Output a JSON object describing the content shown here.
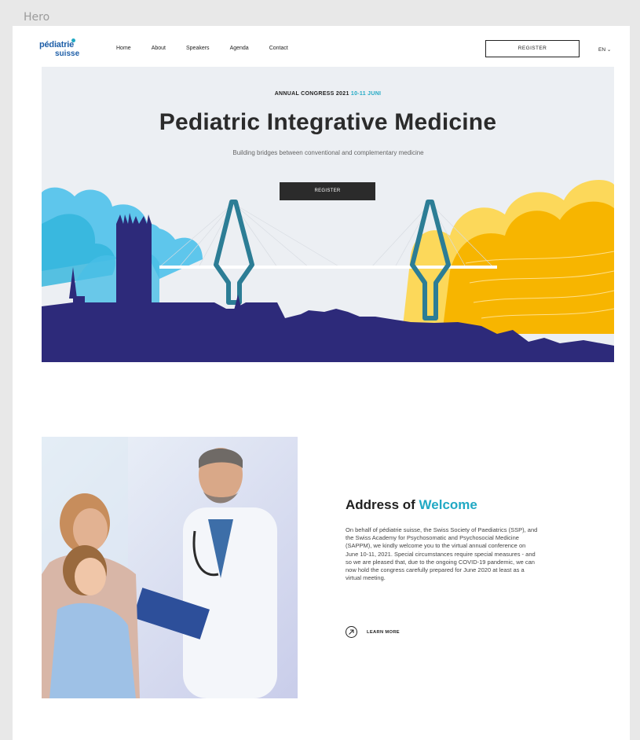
{
  "frame_label": "Hero",
  "nav": {
    "logo_line1": "pédiatrie",
    "logo_line2": "suisse",
    "items": [
      "Home",
      "About",
      "Speakers",
      "Agenda",
      "Contact"
    ],
    "register": "REGISTER",
    "language": "EN ⌄"
  },
  "hero": {
    "eyebrow": "ANNUAL CONGRESS 2021",
    "eyebrow_dates": "10-11 JUNI",
    "title": "Pediatric Integrative Medicine",
    "subtitle": "Building bridges between conventional and complementary medicine",
    "button": "REGISTER"
  },
  "welcome": {
    "title_part1": "Address of",
    "title_part2": "Welcome",
    "body": "On behalf of pédiatrie suisse, the Swiss Society of Paediatrics (SSP), and the Swiss Academy for Psychosomatic and Psychosocial Medicine (SAPPM), we kindly welcome you to the virtual annual conference on June 10-11, 2021. Special circumstances require special measures - and so we are pleased that, due to the ongoing COVID-19 pandemic, we can now hold the congress carefully prepared for June 2020 at least as a virtual meeting.",
    "learn_more": "LEARN MORE"
  },
  "colors": {
    "accent": "#21a9c4",
    "navy": "#2d2a7a",
    "sky_blue": "#5ec6ec",
    "yellow": "#f7b500",
    "light_yellow": "#fcd85a",
    "teal": "#2c7d95",
    "dark_button": "#2b2b2b"
  }
}
